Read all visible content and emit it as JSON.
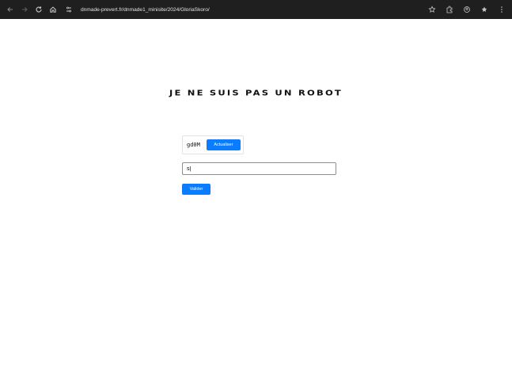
{
  "browser": {
    "url": "dnmade-prevert.fr/dnmade1_minisite/2024/GloriaSkoro/",
    "icons": [
      "back-arrow-icon",
      "forward-arrow-icon",
      "reload-icon",
      "home-icon",
      "site-settings-icon",
      "bookmark-star-icon",
      "extensions-icon",
      "profile-icon",
      "extension-pin-icon",
      "menu-icon"
    ]
  },
  "page": {
    "title": "JE NE SUIS PAS UN ROBOT",
    "captcha": {
      "code": "gd0M",
      "refresh_label": "Actualiser"
    },
    "answer": {
      "value": "s|"
    },
    "submit_label": "Valider"
  },
  "colors": {
    "accent": "#0a7cff",
    "browser_bar": "#1f1f1f",
    "background": "#ffffff"
  }
}
